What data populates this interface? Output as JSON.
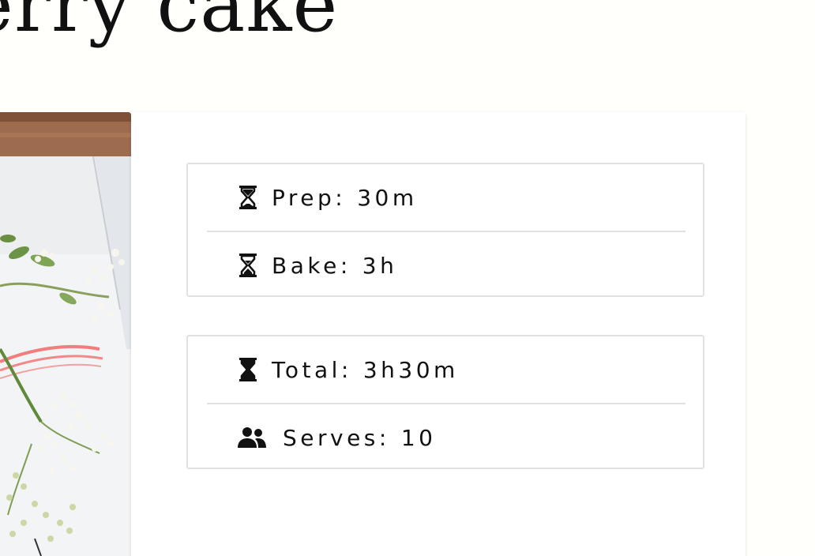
{
  "header": {
    "title": "erry cake"
  },
  "stats": {
    "prep": {
      "label": "Prep",
      "value": "30m",
      "icon": "hourglass-start-icon"
    },
    "bake": {
      "label": "Bake",
      "value": "3h",
      "icon": "hourglass-half-icon"
    },
    "total": {
      "label": "Total",
      "value": "3h30m",
      "icon": "hourglass-end-icon"
    },
    "serves": {
      "label": "Serves",
      "value": "10",
      "icon": "users-icon"
    },
    "separator": ":"
  },
  "colors": {
    "background": "#fffffb",
    "card": "#ffffff",
    "border": "#e1e1e1",
    "text": "#111111"
  }
}
